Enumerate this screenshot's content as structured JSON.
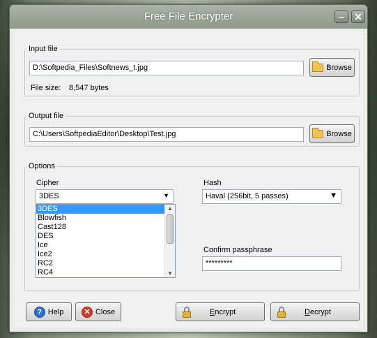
{
  "window": {
    "title": "Free File Encrypter",
    "minimize_glyph": "–",
    "close_glyph": "✕"
  },
  "input_group": {
    "legend": "Input file",
    "path": "D:\\Softpedia_Files\\Softnews_t.jpg",
    "browse_label": "Browse",
    "file_size_label": "File size:",
    "file_size_value": "8,547 bytes"
  },
  "output_group": {
    "legend": "Output file",
    "path": "C:\\Users\\SoftpediaEditor\\Desktop\\Test.jpg",
    "browse_label": "Browse"
  },
  "options_group": {
    "legend": "Options",
    "cipher_label": "Cipher",
    "cipher_selected": "3DES",
    "cipher_options": [
      "3DES",
      "Blowfish",
      "Cast128",
      "DES",
      "Ice",
      "Ice2",
      "RC2",
      "RC4"
    ],
    "hash_label": "Hash",
    "hash_selected": "Haval (256bit, 5 passes)",
    "confirm_label": "Confirm passphrase",
    "confirm_value": "*********"
  },
  "buttons": {
    "help": "Help",
    "close": "Close",
    "encrypt_prefix": "E",
    "encrypt_rest": "ncrypt",
    "decrypt_prefix": "D",
    "decrypt_rest": "ecrypt"
  },
  "icons": {
    "help": "help-icon",
    "close": "close-icon",
    "lock": "lock-icon",
    "folder": "folder-icon"
  },
  "colors": {
    "selection": "#3399ff",
    "help_blue": "#2f6fc9",
    "close_red": "#d23a2a"
  }
}
